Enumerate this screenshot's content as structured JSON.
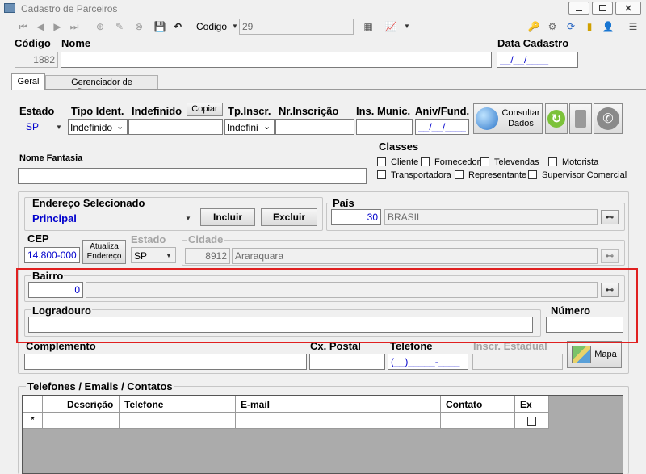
{
  "window": {
    "title": "Cadastro de Parceiros"
  },
  "toolbar": {
    "codigo_label": "Codigo",
    "codigo_value": "29"
  },
  "header": {
    "codigo_label": "Código",
    "codigo_value": "1882",
    "nome_label": "Nome",
    "nome_value": "",
    "data_cadastro_label": "Data Cadastro",
    "data_cadastro_value": "__/__/____"
  },
  "tabs": [
    {
      "label": "Geral"
    },
    {
      "label": "Gerenciador de Documentos"
    }
  ],
  "form": {
    "estado_label": "Estado",
    "estado_value": "SP",
    "tipo_ident_label": "Tipo Ident.",
    "indefinido_label": "Indefinido",
    "tipo_ident_value": "Indefinido",
    "copiar_label": "Copiar",
    "tp_inscr_label": "Tp.Inscr.",
    "tp_inscr_value": "Indefini",
    "nr_inscricao_label": "Nr.Inscrição",
    "ins_munic_label": "Ins. Munic.",
    "aniv_fund_label": "Aniv/Fund.",
    "aniv_fund_value": "__/__/____",
    "consultar_dados_label": "Consultar Dados",
    "nome_fantasia_label": "Nome Fantasia",
    "classes_label": "Classes",
    "classes": [
      "Cliente",
      "Fornecedor",
      "Televendas",
      "Motorista",
      "Transportadora",
      "Representante",
      "Supervisor Comercial"
    ],
    "endereco_selecionado_label": "Endereço Selecionado",
    "endereco_value": "Principal",
    "incluir_label": "Incluir",
    "excluir_label": "Excluir",
    "pais_label": "País",
    "pais_code": "30",
    "pais_name": "BRASIL",
    "cep_label": "CEP",
    "cep_value": "14.800-000",
    "atualiza_endereco_label": "Atualiza Endereço",
    "estado2_label": "Estado",
    "estado2_value": "SP",
    "cidade_label": "Cidade",
    "cidade_code": "8912",
    "cidade_name": "Araraquara",
    "bairro_label": "Bairro",
    "bairro_code": "0",
    "logradouro_label": "Logradouro",
    "numero_label": "Número",
    "complemento_label": "Complemento",
    "cx_postal_label": "Cx. Postal",
    "telefone_label": "Telefone",
    "telefone_value": "(__)_____-____",
    "inscr_estadual_label": "Inscr. Estadual",
    "mapa_label": "Mapa"
  },
  "contacts": {
    "section_label": "Telefones / Emails / Contatos",
    "columns": [
      "Descrição",
      "Telefone",
      "E-mail",
      "Contato",
      "Ex"
    ],
    "new_row_marker": "*"
  },
  "colors": {
    "highlight": "#e02020",
    "accent_blue": "#0000cc"
  }
}
